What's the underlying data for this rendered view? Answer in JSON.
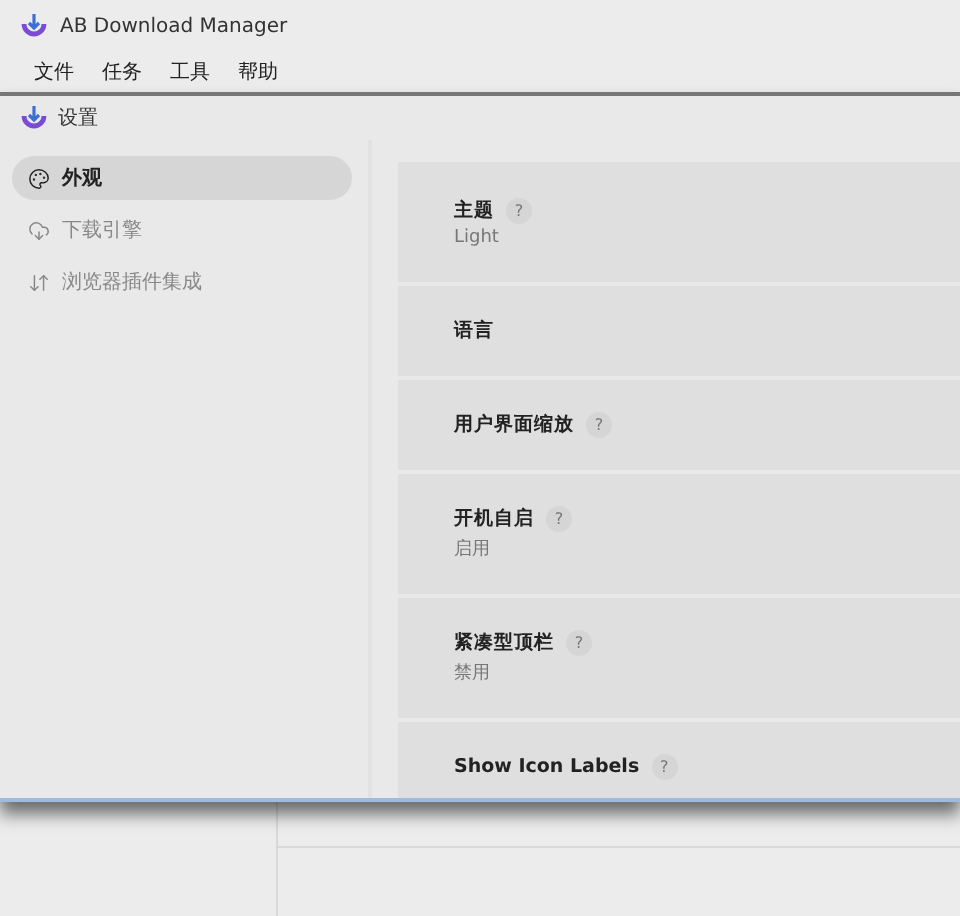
{
  "main_window": {
    "title": "AB Download Manager",
    "menu": [
      "文件",
      "任务",
      "工具",
      "帮助"
    ]
  },
  "settings_window": {
    "title": "设置",
    "sidebar": [
      {
        "label": "外观",
        "kind": "palette",
        "selected": true
      },
      {
        "label": "下载引擎",
        "kind": "cloud",
        "selected": false
      },
      {
        "label": "浏览器插件集成",
        "kind": "arrows",
        "selected": false
      }
    ],
    "rows": [
      {
        "label": "主题",
        "help": "?",
        "value": "Light"
      },
      {
        "label": "语言"
      },
      {
        "label": "用户界面缩放",
        "help": "?"
      },
      {
        "label": "开机自启",
        "help": "?",
        "value": "启用"
      },
      {
        "label": "紧凑型顶栏",
        "help": "?",
        "value": "禁用"
      },
      {
        "label": "Show Icon Labels",
        "help": "?"
      }
    ]
  }
}
